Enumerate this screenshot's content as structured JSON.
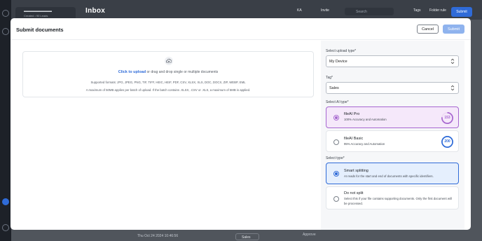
{
  "background": {
    "inbox_title": "Inbox",
    "toolbar": {
      "user_initials": "KA",
      "invite_label": "Invite",
      "search_placeholder": "Search",
      "tags_label": "Tags",
      "folder_label": "Folder rule",
      "submit_label": "Submit"
    },
    "side_title": "▬▬▬▬▬▬▬▬",
    "side_sub": "Created • 90 Leads",
    "footer": {
      "date_label": "Thu Oct 24 2024 10:46:56",
      "sales_label": "Sales",
      "approve_label": "Approve"
    }
  },
  "modal": {
    "title": "Submit documents",
    "cancel_label": "Cancel",
    "submit_label": "Submit",
    "upload": {
      "link_text": "Click to upload",
      "hint": " or drag and drop single or multiple documents",
      "formats": "Supported formats: JPG, JPEG, PNG, TIF, TIFF, HEIC, HEIF, PDF, CSV, XLSX, XLS, DOC, DOCX, ZIP, WEBP, EML",
      "limit": "A maximum of 50MB applies per batch of upload. If the batch contains .XLSX, .CSV or .XLS, a maximum of 5MB is applied."
    },
    "upload_type": {
      "label": "Select upload type*",
      "value": "My Device"
    },
    "tag": {
      "label": "Tag*",
      "value": "Sales"
    },
    "ai_type": {
      "label": "Select AI type*",
      "options": [
        {
          "title": "fileAI Pro",
          "desc": "100% Accuracy and Automation",
          "credits": "153",
          "selected": true,
          "credit_fraction": 0.77
        },
        {
          "title": "fileAI Basic",
          "desc": "95% Accuracy and Automation",
          "credits": "200",
          "selected": false,
          "credit_fraction": 1.0
        }
      ]
    },
    "split_type": {
      "label": "Select type*",
      "options": [
        {
          "title": "Smart splitting",
          "desc": "AI reads for the start and end of documents with specific identifiers.",
          "selected": true
        },
        {
          "title": "Do not split",
          "desc": "Select this if your file contains supporting documents. Only the first document will be processed.",
          "selected": false
        }
      ]
    },
    "colors": {
      "primary": "#2f6bd8",
      "pro_accent": "#a767d0",
      "submit_disabled": "#8fb3ee"
    }
  }
}
